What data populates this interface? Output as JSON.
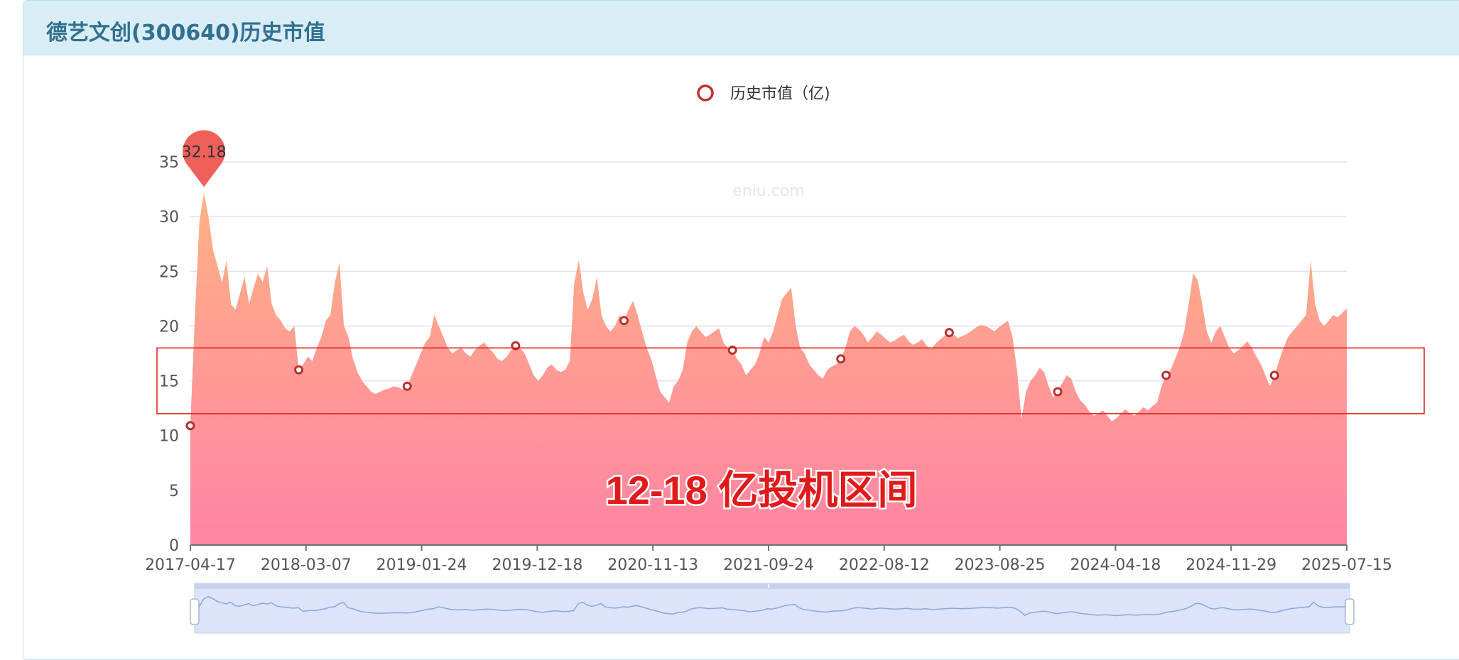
{
  "panel": {
    "title": "德艺文创(300640)历史市值"
  },
  "chart_data": {
    "type": "area",
    "legend": {
      "label": "历史市值（亿)",
      "position": "top-center"
    },
    "watermark": "eniu.com",
    "ylim": [
      0,
      35
    ],
    "yticks": [
      0,
      5,
      10,
      15,
      20,
      25,
      30,
      35
    ],
    "x_tick_labels": [
      "2017-04-17",
      "2018-03-07",
      "2019-01-24",
      "2019-12-18",
      "2020-11-13",
      "2021-09-24",
      "2022-08-12",
      "2023-08-25",
      "2024-04-18",
      "2024-11-29",
      "2025-07-15"
    ],
    "max_label": "32.18",
    "max_index": 3,
    "series": [
      {
        "name": "历史市值（亿)",
        "values": [
          10.9,
          21,
          29.5,
          32.18,
          30,
          27,
          25.5,
          24,
          26,
          22,
          21.5,
          23,
          24.5,
          22,
          23.5,
          24.8,
          24,
          25.5,
          22,
          21,
          20.5,
          19.8,
          19.5,
          20,
          16,
          16.5,
          17.2,
          16.8,
          18,
          19,
          20.5,
          21,
          24,
          25.8,
          20,
          19,
          17,
          15.8,
          15,
          14.5,
          14,
          13.8,
          14,
          14.2,
          14.3,
          14.5,
          14.4,
          14.2,
          14.5,
          15.5,
          16.5,
          17.5,
          18.5,
          19,
          21,
          20,
          19,
          18,
          17.5,
          17.8,
          18,
          17.5,
          17.2,
          17.8,
          18.2,
          18.5,
          18,
          17.6,
          17,
          16.8,
          17.2,
          17.8,
          18.2,
          18,
          17.5,
          16.5,
          15.5,
          15,
          15.5,
          16.2,
          16.5,
          16,
          15.8,
          16,
          16.8,
          24,
          26,
          23,
          21.5,
          22.5,
          24.5,
          21,
          20,
          19.5,
          20,
          21,
          20.5,
          21.5,
          22.3,
          21,
          19.5,
          18,
          17,
          15.5,
          14,
          13.5,
          13,
          14.5,
          15,
          16,
          18.5,
          19.5,
          20,
          19.5,
          19,
          19.2,
          19.5,
          19.8,
          18.5,
          18,
          17.8,
          17,
          16.5,
          15.5,
          16,
          16.5,
          17.5,
          19,
          18.5,
          19.5,
          21,
          22.5,
          23,
          23.5,
          20,
          18,
          17.5,
          16.5,
          16,
          15.5,
          15.2,
          16,
          16.3,
          16.5,
          17,
          18,
          19.5,
          20,
          19.7,
          19.2,
          18.5,
          19,
          19.5,
          19.2,
          18.8,
          18.5,
          18.7,
          19,
          19.2,
          18.6,
          18.3,
          18.5,
          18.8,
          18.2,
          17.9,
          18.4,
          18.8,
          19.1,
          19.4,
          19.2,
          18.9,
          19.1,
          19.3,
          19.6,
          19.9,
          20.1,
          20,
          19.8,
          19.5,
          19.9,
          20.2,
          20.5,
          19,
          16,
          11.5,
          14,
          15,
          15.5,
          16.2,
          15.8,
          14.5,
          13.5,
          14,
          14.8,
          15.5,
          15.2,
          14,
          13.2,
          12.8,
          12.2,
          11.8,
          12,
          12.3,
          11.8,
          11.3,
          11.6,
          12,
          12.4,
          12,
          11.8,
          12.2,
          12.6,
          12.3,
          12.7,
          13,
          14.5,
          15.5,
          16,
          17,
          18,
          19.5,
          22,
          24.8,
          24.2,
          22,
          19.5,
          18.5,
          19.5,
          20,
          19,
          18,
          17.5,
          17.8,
          18.2,
          18.6,
          18,
          17.2,
          16.5,
          15.5,
          14.5,
          15.5,
          16.8,
          18,
          19,
          19.5,
          20,
          20.5,
          21,
          26,
          22,
          20.5,
          20,
          20.5,
          21,
          20.8,
          21.2,
          21.6
        ]
      }
    ],
    "marker_indices": [
      0,
      24,
      48,
      72,
      96,
      120,
      144,
      168,
      192,
      216,
      240
    ],
    "annotation": {
      "label": "12-18 亿投机区间",
      "range": [
        12,
        18
      ]
    },
    "datazoom": {
      "visible": true
    }
  },
  "colors": {
    "header_bg": "#d9edf7",
    "title": "#31708f",
    "legend_ring": "#c0302f",
    "area_top": "#ffb184",
    "area_bottom": "#ff84a4",
    "marker": "#b8322c",
    "max_pin": "#f0605a",
    "grid": "#dde3f0",
    "axis_text": "#555555",
    "annotation_red": "#e01a1a"
  }
}
